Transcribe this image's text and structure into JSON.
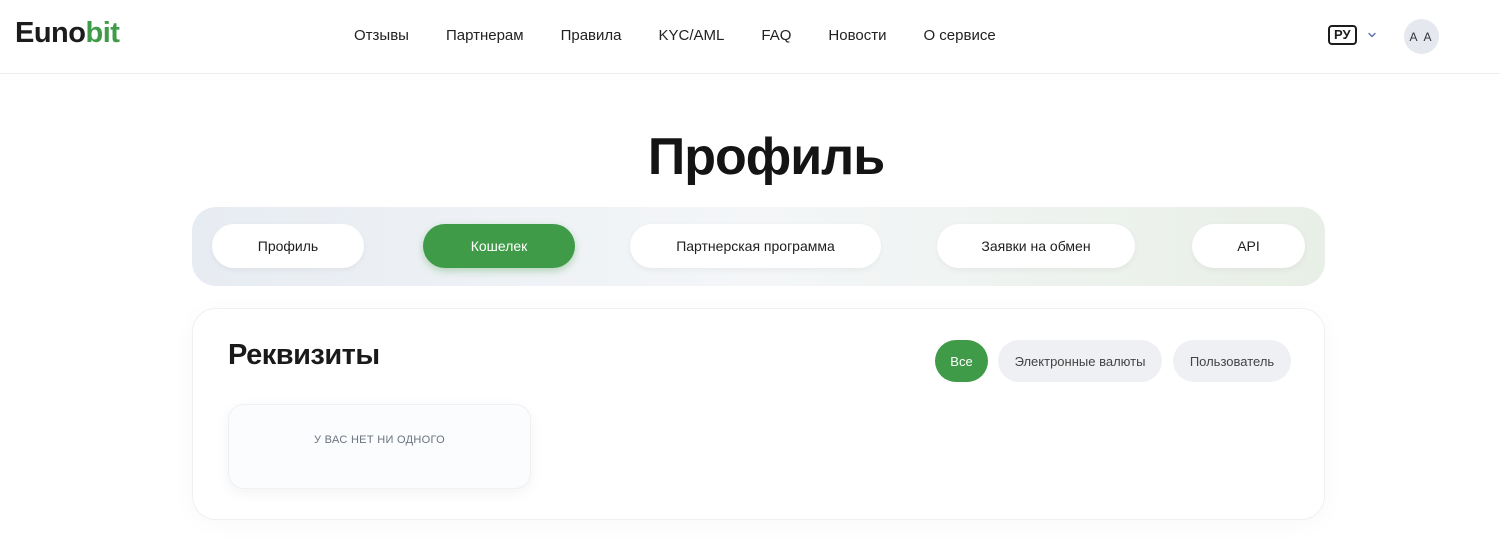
{
  "header": {
    "logo": {
      "part1": "Euno",
      "part2": "bit"
    },
    "nav": [
      "Отзывы",
      "Партнерам",
      "Правила",
      "KYC/AML",
      "FAQ",
      "Новости",
      "О сервисе"
    ],
    "lang": "РУ",
    "avatar": "A A"
  },
  "page_title": "Профиль",
  "tabs": [
    "Профиль",
    "Кошелек",
    "Партнерская программа",
    "Заявки на обмен",
    "API"
  ],
  "active_tab": "Кошелек",
  "requisites": {
    "title": "Реквизиты",
    "filters": [
      "Все",
      "Электронные валюты",
      "Пользователь"
    ],
    "active_filter": "Все",
    "empty_text": "У ВАС НЕТ НИ ОДНОГО"
  },
  "colors": {
    "accent": "#3f9b48"
  },
  "icons": {
    "lang_dropdown": "chevron-down-icon"
  }
}
